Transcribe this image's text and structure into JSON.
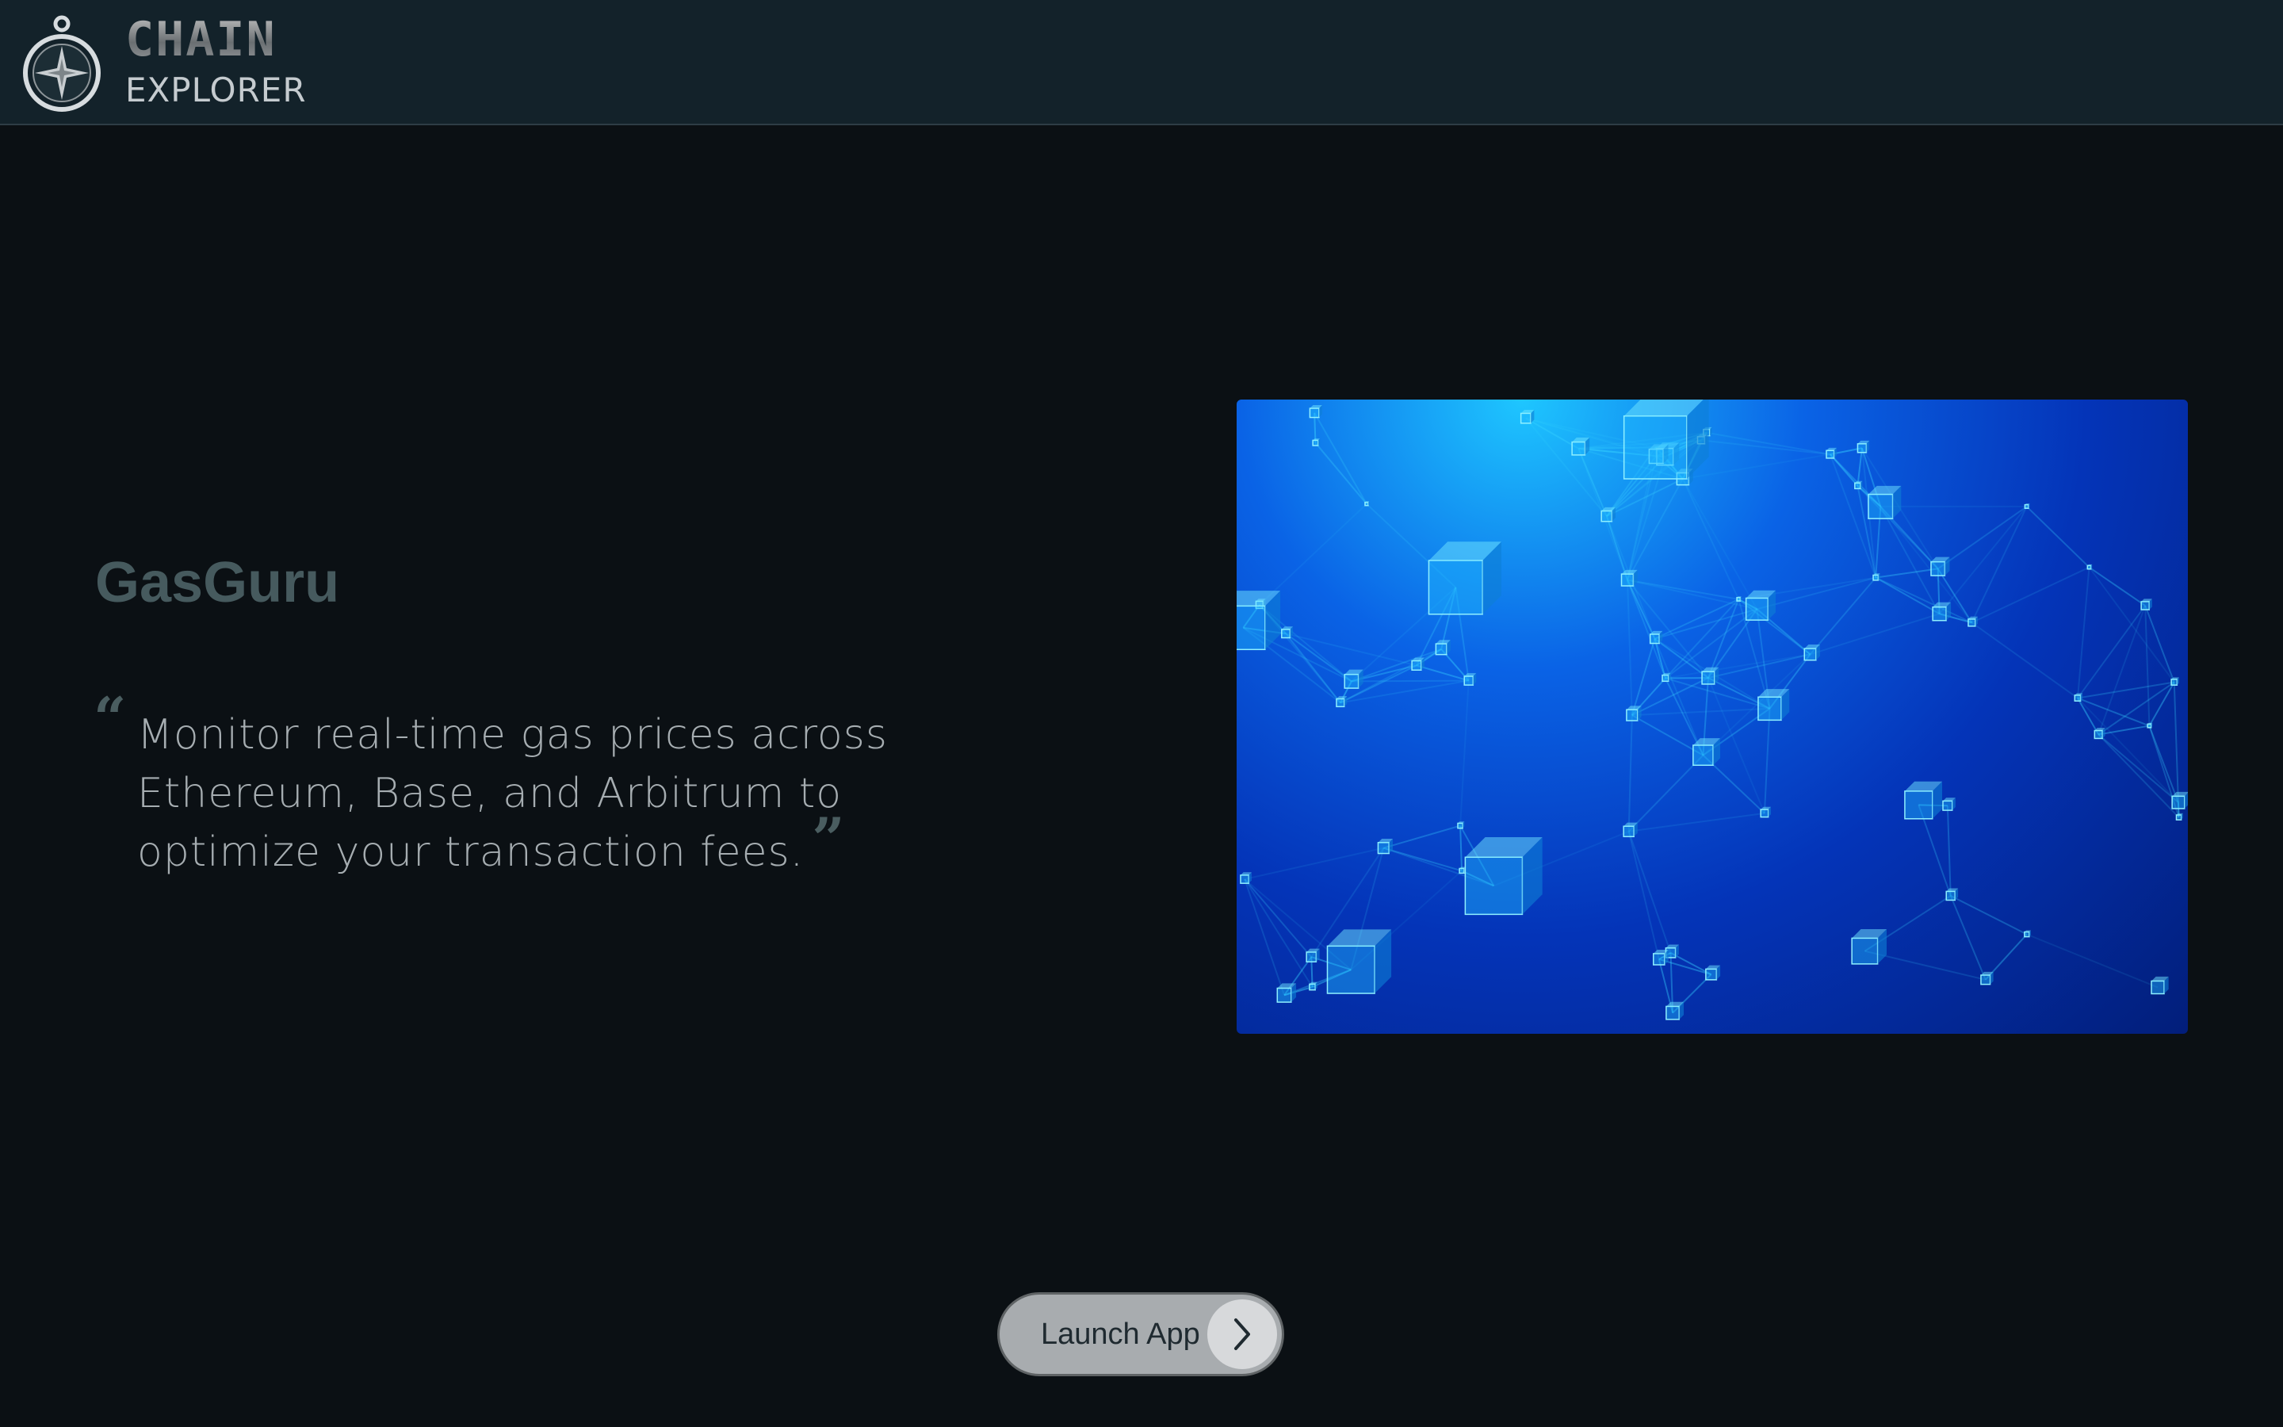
{
  "header": {
    "logo_top": "CHAIN",
    "logo_bottom": "EXPLORER",
    "logo_icon": "compass-icon"
  },
  "hero": {
    "title": "GasGuru",
    "description": "Monitor real-time gas prices across Ethereum, Base, and Arbitrum to optimize your transaction fees.",
    "quote_open": "“",
    "quote_close": "”",
    "image_icon": "blockchain-network-image"
  },
  "cta": {
    "label": "Launch App",
    "icon": "chevron-right-icon"
  },
  "colors": {
    "background": "#0b1014",
    "header": "#13222a",
    "title": "#465a5e",
    "text": "#a6adb1",
    "button": "#a8acaf"
  }
}
